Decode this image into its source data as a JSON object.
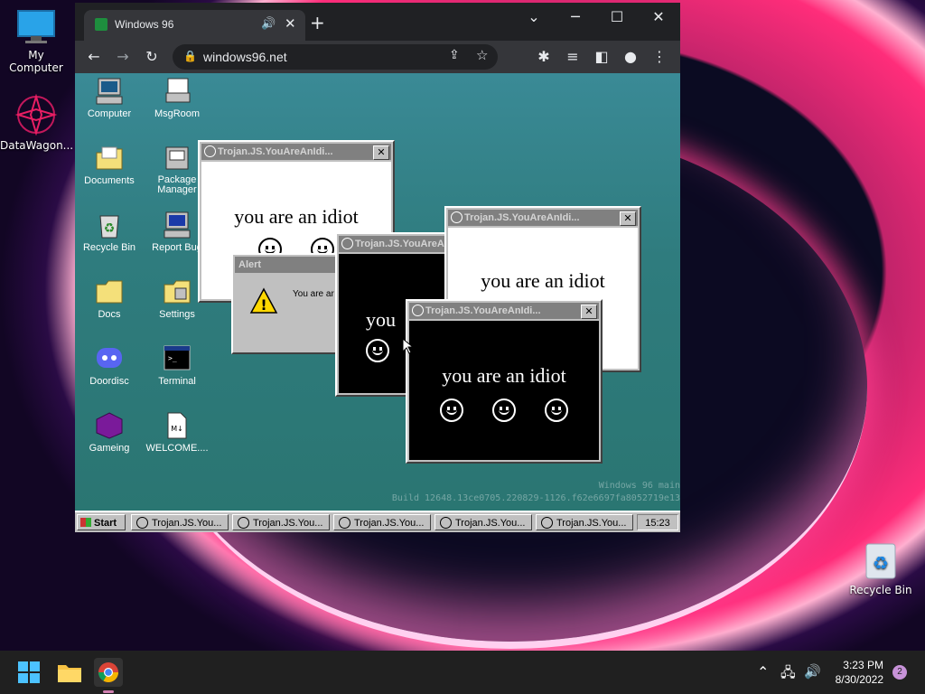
{
  "desktop": {
    "icons": [
      {
        "label": "My Computer"
      },
      {
        "label": "DataWagon..."
      },
      {
        "label": "Recycle Bin"
      }
    ]
  },
  "browser": {
    "tab_title": "Windows 96",
    "url": "windows96.net"
  },
  "win96": {
    "icons": [
      {
        "label": "Computer"
      },
      {
        "label": "MsgRoom"
      },
      {
        "label": "Documents"
      },
      {
        "label": "Package Manager"
      },
      {
        "label": "Recycle Bin"
      },
      {
        "label": "Report Bug"
      },
      {
        "label": "Docs"
      },
      {
        "label": "Settings"
      },
      {
        "label": "Doordisc"
      },
      {
        "label": "Terminal"
      },
      {
        "label": "Gameing"
      },
      {
        "label": "WELCOME...."
      }
    ],
    "popup_title": "Trojan.JS.YouAreAnIdi...",
    "popup_text": "you are an idiot",
    "popup_text_partial": "you",
    "alert_title": "Alert",
    "alert_text": "You are ar",
    "watermark_line1": "Windows 96 main",
    "watermark_line2": "Build 12648.13ce0705.220829-1126.f62e6697fa8052719e13",
    "taskbar": {
      "start": "Start",
      "tasks": [
        "Trojan.JS.You...",
        "Trojan.JS.You...",
        "Trojan.JS.You...",
        "Trojan.JS.You...",
        "Trojan.JS.You..."
      ],
      "clock": "15:23"
    }
  },
  "taskbar": {
    "time": "3:23 PM",
    "date": "8/30/2022",
    "notifications": "2"
  }
}
